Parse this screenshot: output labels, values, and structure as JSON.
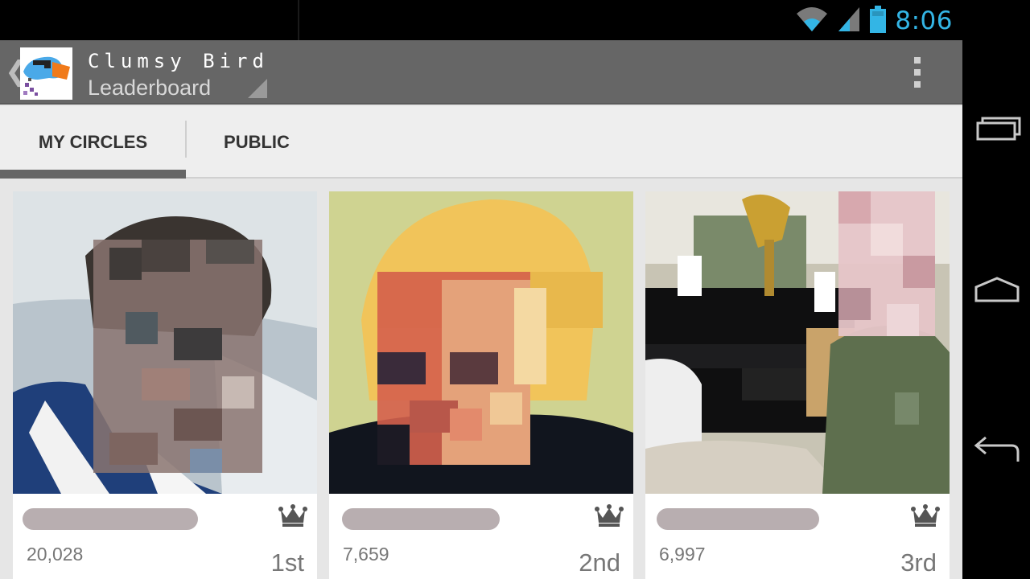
{
  "status_bar": {
    "time": "8:06",
    "accent": "#33b5e5",
    "icons": [
      "wifi-icon",
      "cell-signal-icon",
      "battery-icon"
    ]
  },
  "action_bar": {
    "up_caret": "❮",
    "app_title": "Clumsy Bird",
    "subtitle": "Leaderboard",
    "icons": [
      "app-icon",
      "spinner-triangle-icon",
      "overflow-menu-icon"
    ]
  },
  "tabs": [
    {
      "label": "MY CIRCLES",
      "selected": true
    },
    {
      "label": "PUBLIC",
      "selected": false
    }
  ],
  "leaderboard": [
    {
      "score": "20,028",
      "rank": "1st",
      "icon": "crown-icon"
    },
    {
      "score": "7,659",
      "rank": "2nd",
      "icon": "crown-icon"
    },
    {
      "score": "6,997",
      "rank": "3rd",
      "icon": "crown-icon"
    }
  ],
  "nav_bar": {
    "icons": [
      "recent-apps-icon",
      "home-icon",
      "back-icon"
    ]
  },
  "colors": {
    "action_bar": "#666666",
    "tab_bar": "#eeeeee",
    "tab_indicator": "#666666",
    "card_text": "#777777",
    "background": "#e6e6e6"
  }
}
